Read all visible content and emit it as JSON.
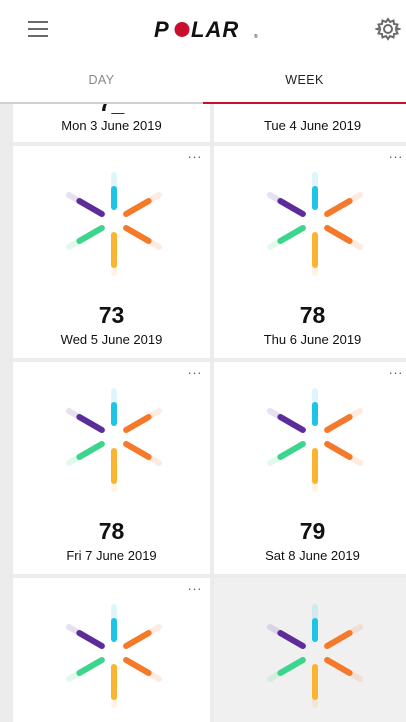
{
  "app": {
    "brand": "POLAR",
    "menu_icon": "hamburger-menu-icon",
    "settings_icon": "gear-icon"
  },
  "tabs": [
    {
      "label": "DAY",
      "active": false
    },
    {
      "label": "WEEK",
      "active": true
    }
  ],
  "colors": {
    "accent_red": "#c8102e",
    "burst_cyan": "#1ec3e6",
    "burst_orange": "#f5792b",
    "burst_amber": "#fbb431",
    "burst_green": "#3bd58d",
    "burst_purple": "#5c2d9a"
  },
  "cards": [
    {
      "date": "Mon 3 June 2019"
    },
    {
      "date": "Tue 4 June 2019"
    },
    {
      "score": "73",
      "date": "Wed 5 June 2019",
      "more_label": "···"
    },
    {
      "score": "78",
      "date": "Thu 6 June 2019",
      "more_label": "···"
    },
    {
      "score": "78",
      "date": "Fri 7 June 2019",
      "more_label": "···"
    },
    {
      "score": "79",
      "date": "Sat 8 June 2019",
      "more_label": "···"
    },
    {
      "more_label": "···"
    },
    {}
  ]
}
